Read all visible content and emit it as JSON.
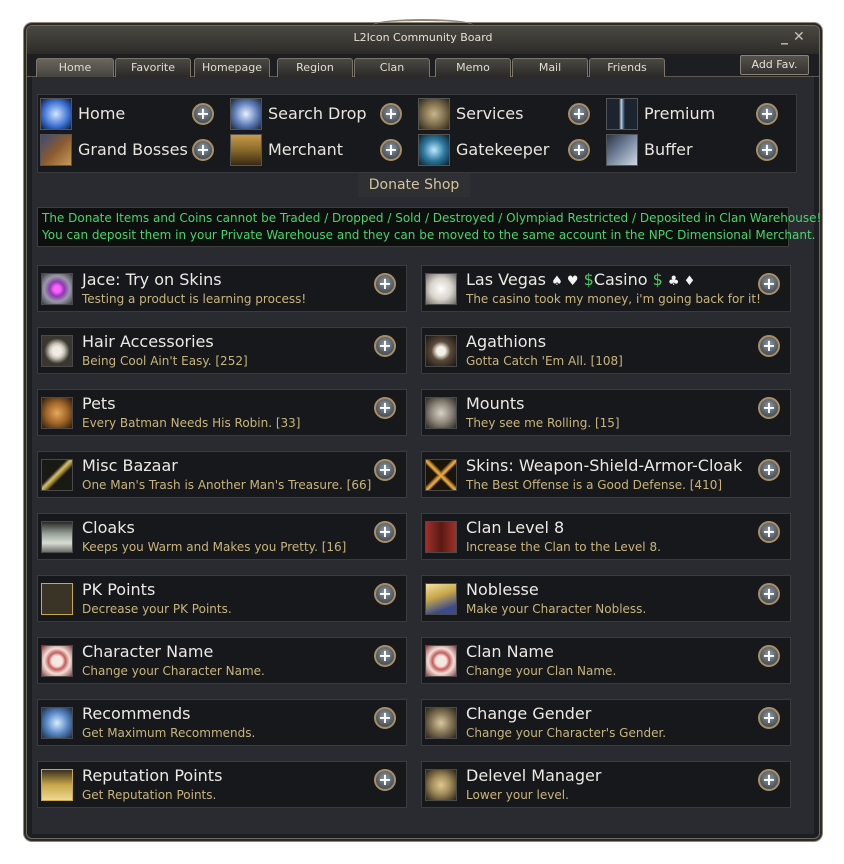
{
  "window": {
    "title": "L2Icon Community Board",
    "minimize": "_",
    "close": "✕"
  },
  "tabs": [
    {
      "label": "Home"
    },
    {
      "label": "Favorite"
    },
    {
      "label": "Homepage"
    },
    {
      "label": "Region"
    },
    {
      "label": "Clan"
    },
    {
      "label": "Memo"
    },
    {
      "label": "Mail"
    },
    {
      "label": "Friends"
    }
  ],
  "add_fav": "Add Fav.",
  "nav": [
    {
      "label": "Home",
      "icon": "star-burst-icon",
      "color": "#3b6fd1"
    },
    {
      "label": "Search Drop",
      "icon": "spark-search-icon",
      "color": "#5c7db8"
    },
    {
      "label": "Services",
      "icon": "gear-icon",
      "color": "#7a6a4a"
    },
    {
      "label": "Premium",
      "icon": "sword-icon",
      "color": "#6c8aa8"
    },
    {
      "label": "Grand Bosses",
      "icon": "dragon-icon",
      "color": "#8a5a2f"
    },
    {
      "label": "Merchant",
      "icon": "chest-icon",
      "color": "#8a6a2a"
    },
    {
      "label": "Gatekeeper",
      "icon": "portal-icon",
      "color": "#2f7aa0"
    },
    {
      "label": "Buffer",
      "icon": "warrior-icon",
      "color": "#7888a0"
    }
  ],
  "shop_title": "Donate Shop",
  "notice": [
    "The Donate Items and Coins cannot be Traded / Dropped / Sold / Destroyed / Olympiad Restricted / Deposited in Clan Warehouse!",
    "You can deposit them in your Private Warehouse and they can be moved to the same account in the NPC Dimensional Merchant."
  ],
  "casino": {
    "title_a": "Las Vegas ",
    "suits_a": "♠ ♥",
    "dollar_a": "$",
    "word": "Casino",
    "dollar_b": "$",
    "suits_b": "♣ ♦"
  },
  "items": [
    {
      "title": "Jace: Try on Skins",
      "sub": "Testing a product is learning process!",
      "icon": "orb-icon",
      "color": "#8a3ab0"
    },
    {
      "title": "",
      "sub": "The casino took my money, i'm going back for it!",
      "icon": "dice-icon",
      "color": "#d8d4cc"
    },
    {
      "title": "Hair Accessories",
      "sub": "Being Cool Ain't Easy.  [252]",
      "icon": "skull-mask-icon",
      "color": "#c8c2b6"
    },
    {
      "title": "Agathions",
      "sub": "Gotta Catch 'Em All.  [108]",
      "icon": "pet-ball-icon",
      "color": "#5a4a3a"
    },
    {
      "title": "Pets",
      "sub": "Every Batman Needs His Robin.  [33]",
      "icon": "claw-icon",
      "color": "#a0662a"
    },
    {
      "title": "Mounts",
      "sub": "They see me Rolling.  [15]",
      "icon": "horse-icon",
      "color": "#8a8478"
    },
    {
      "title": "Misc Bazaar",
      "sub": "One Man's Trash is Another Man's Treasure. [66]",
      "icon": "stick-icon",
      "color": "#a08a3a"
    },
    {
      "title": "Skins: Weapon-Shield-Armor-Cloak",
      "sub": "The Best Offense is a Good Defense.  [410]",
      "icon": "crossed-swords-icon",
      "color": "#c88a2a"
    },
    {
      "title": "Cloaks",
      "sub": "Keeps you Warm and Makes you Pretty.  [16]",
      "icon": "cloak-icon",
      "color": "#9aa49a"
    },
    {
      "title": "Clan Level 8",
      "sub": "Increase the Clan to the Level 8.",
      "icon": "banner-icon",
      "color": "#a0302a"
    },
    {
      "title": "PK Points",
      "sub": "Decrease your PK Points.",
      "icon": "pk-icon",
      "color": "#3a3426"
    },
    {
      "title": "Noblesse",
      "sub": "Make your Character Nobless.",
      "icon": "wing-icon",
      "color": "#c8a84a"
    },
    {
      "title": "Character Name",
      "sub": "Change your Character Name.",
      "icon": "scroll-icon",
      "color": "#c85a5a"
    },
    {
      "title": "Clan Name",
      "sub": "Change your Clan Name.",
      "icon": "scroll-icon",
      "color": "#c85a5a"
    },
    {
      "title": "Recommends",
      "sub": "Get Maximum Recommends.",
      "icon": "hand-icon",
      "color": "#5a8ac8"
    },
    {
      "title": "Change Gender",
      "sub": "Change your Character's Gender.",
      "icon": "portrait-icon",
      "color": "#8a7a5a"
    },
    {
      "title": "Reputation Points",
      "sub": "Get Reputation Points.",
      "icon": "crown-icon",
      "color": "#c8a84a"
    },
    {
      "title": "Delevel Manager",
      "sub": "Lower your level.",
      "icon": "horn-icon",
      "color": "#a08a5a"
    }
  ]
}
